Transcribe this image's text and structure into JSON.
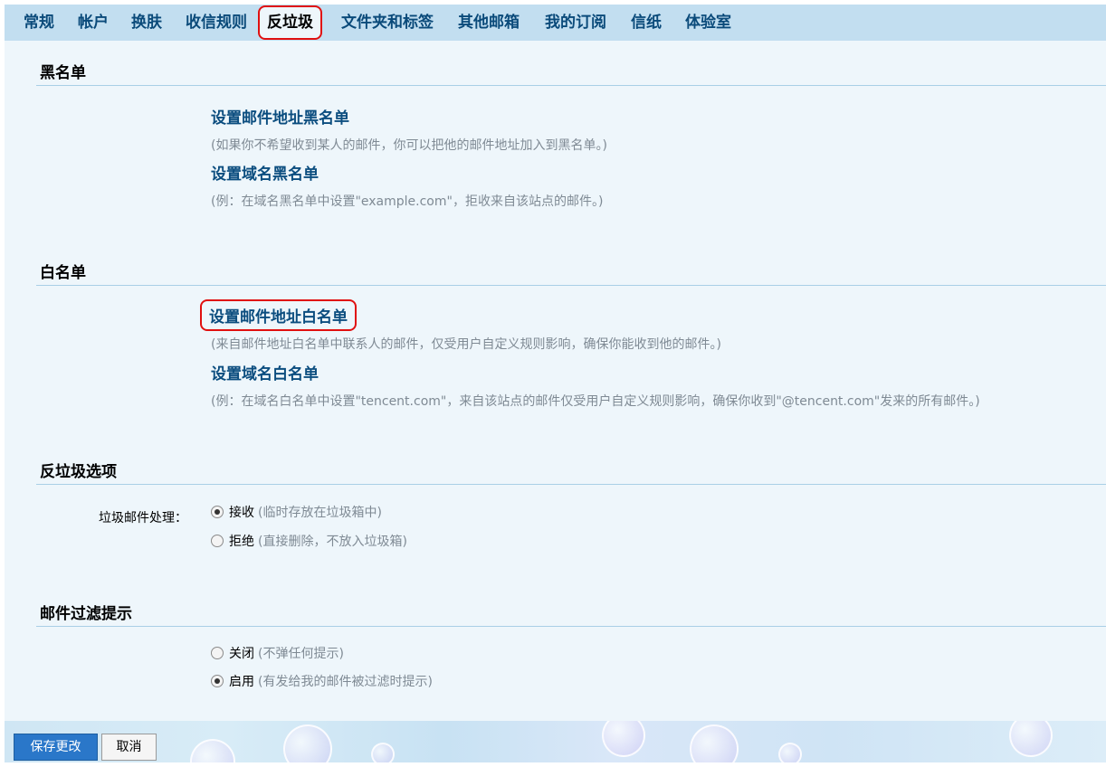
{
  "tabs": [
    {
      "label": "常规"
    },
    {
      "label": "帐户"
    },
    {
      "label": "换肤"
    },
    {
      "label": "收信规则"
    },
    {
      "label": "反垃圾",
      "active": true
    },
    {
      "label": "文件夹和标签"
    },
    {
      "label": "其他邮箱"
    },
    {
      "label": "我的订阅"
    },
    {
      "label": "信纸"
    },
    {
      "label": "体验室"
    }
  ],
  "blacklist": {
    "title": "黑名单",
    "address_link": "设置邮件地址黑名单",
    "address_hint": "(如果你不希望收到某人的邮件，你可以把他的邮件地址加入到黑名单。)",
    "domain_link": "设置域名黑名单",
    "domain_hint": "(例：在域名黑名单中设置\"example.com\"，拒收来自该站点的邮件。)"
  },
  "whitelist": {
    "title": "白名单",
    "address_link": "设置邮件地址白名单",
    "address_hint": "(来自邮件地址白名单中联系人的邮件，仅受用户自定义规则影响，确保你能收到他的邮件。)",
    "domain_link": "设置域名白名单",
    "domain_hint": "(例：在域名白名单中设置\"tencent.com\"，来自该站点的邮件仅受用户自定义规则影响，确保你收到\"@tencent.com\"发来的所有邮件。)"
  },
  "antispam_options": {
    "title": "反垃圾选项",
    "row_label": "垃圾邮件处理：",
    "options": [
      {
        "label": "接收",
        "desc": "(临时存放在垃圾箱中)",
        "checked": true
      },
      {
        "label": "拒绝",
        "desc": "(直接删除，不放入垃圾箱)",
        "checked": false
      }
    ]
  },
  "filter_hint": {
    "title": "邮件过滤提示",
    "options": [
      {
        "label": "关闭",
        "desc": "(不弹任何提示)",
        "checked": false
      },
      {
        "label": "启用",
        "desc": "(有发给我的邮件被过滤时提示)",
        "checked": true
      }
    ]
  },
  "buttons": {
    "save": "保存更改",
    "cancel": "取消"
  },
  "colors": {
    "highlight_border": "#e01010",
    "link": "#0b4d7f",
    "tabbar_bg": "#c2def0",
    "primary_button": "#2a77c9"
  }
}
